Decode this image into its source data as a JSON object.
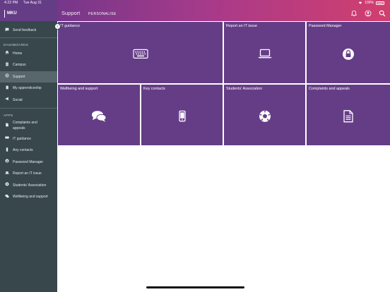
{
  "status_bar": {
    "time": "4:22 PM",
    "date": "Tue Aug 31",
    "battery": "100%"
  },
  "sidebar": {
    "logo": "MKU",
    "feedback": {
      "label": "Send feedback",
      "icon": "chat-bubble-icon"
    },
    "dashboards_heading": "DASHBOARDS",
    "dashboards": [
      {
        "label": "Home",
        "icon": "home-icon",
        "active": false
      },
      {
        "label": "Campus",
        "icon": "building-icon",
        "active": false
      },
      {
        "label": "Support",
        "icon": "lifebuoy-icon",
        "active": true
      },
      {
        "label": "My apprenticeship",
        "icon": "book-icon",
        "active": false
      },
      {
        "label": "Social",
        "icon": "megaphone-icon",
        "active": false
      }
    ],
    "apps_heading": "APPS",
    "apps": [
      {
        "label": "Complaints and appeals",
        "icon": "document-icon"
      },
      {
        "label": "IT guidance",
        "icon": "keyboard-icon"
      },
      {
        "label": "Any contacts",
        "icon": "phone-icon"
      },
      {
        "label": "Password Manager",
        "icon": "lock-icon"
      },
      {
        "label": "Report an IT issue",
        "icon": "laptop-icon"
      },
      {
        "label": "Students' Association",
        "icon": "football-icon"
      },
      {
        "label": "Wellbeing and support",
        "icon": "chat-bubbles-icon"
      }
    ]
  },
  "header": {
    "title": "Support",
    "personalise": "PERSONALISE"
  },
  "tiles": [
    {
      "label": "IT guidance",
      "icon": "keyboard-icon"
    },
    {
      "label": "Report an IT issue",
      "icon": "laptop-icon"
    },
    {
      "label": "Password Manager",
      "icon": "lock-icon"
    },
    {
      "label": "Wellbeing and support",
      "icon": "chat-bubbles-icon"
    },
    {
      "label": "Key contacts",
      "icon": "phone-icon"
    },
    {
      "label": "Students' Association",
      "icon": "football-icon"
    },
    {
      "label": "Complaints and appeals",
      "icon": "document-icon"
    }
  ],
  "colors": {
    "tile": "#653d86",
    "sidebar": "#37474c",
    "header_start": "#75378a",
    "header_end": "#d23f6e"
  }
}
